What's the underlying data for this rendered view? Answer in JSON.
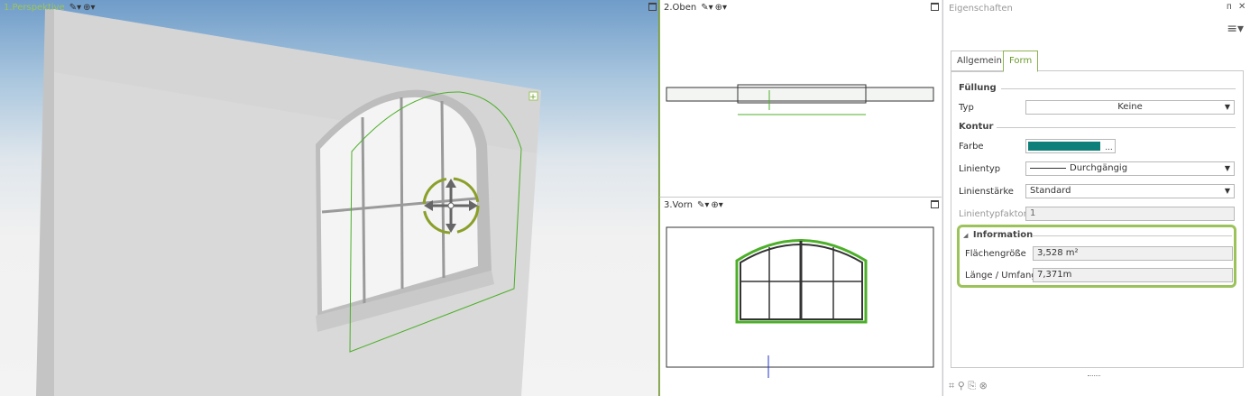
{
  "viewports": {
    "perspective": {
      "label": "1.Perspektive",
      "accent": "#9cc35a"
    },
    "top": {
      "label": "2.Oben"
    },
    "front": {
      "label": "3.Vorn"
    }
  },
  "panel": {
    "title": "Eigenschaften",
    "pin_glyph": "ᴨ",
    "close_glyph": "✕",
    "tabs": [
      "Allgemein",
      "Form"
    ],
    "active_tab": "Form",
    "fill_section": "Füllung",
    "type_label": "Typ",
    "type_value": "Keine",
    "contour_section": "Kontur",
    "color_label": "Farbe",
    "color_value": "#0f7f7a",
    "color_more": "...",
    "linetype_label": "Linientyp",
    "linetype_value": "Durchgängig",
    "linewidth_label": "Linienstärke",
    "linewidth_value": "Standard",
    "linefactor_label": "Linientypfaktor",
    "linefactor_value": "1",
    "info_section": "Information",
    "area_label": "Flächengröße",
    "area_value": "3,528 m²",
    "length_label": "Länge / Umfang",
    "length_value": "7,371m"
  }
}
